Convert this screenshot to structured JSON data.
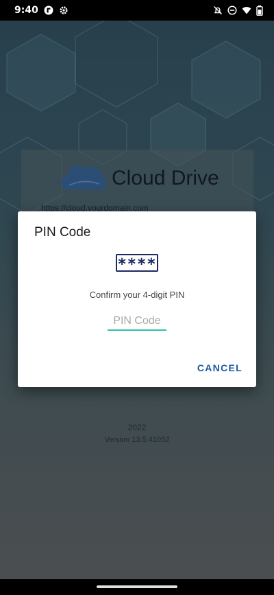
{
  "status_bar": {
    "time": "9:40",
    "icons": [
      "app-logo-icon",
      "settings-gear-icon",
      "notifications-off-icon",
      "do-not-disturb-icon",
      "wifi-icon",
      "battery-icon"
    ]
  },
  "background": {
    "brand_name": "Cloud Drive",
    "server_url": "https://cloud.yourdomain.com",
    "footer_year": "2022",
    "footer_version": "Version 13.5.41052"
  },
  "dialog": {
    "title": "PIN Code",
    "pin_icon_text": "****",
    "message": "Confirm your 4-digit PIN",
    "pin_input_value": "",
    "pin_input_placeholder": "PIN Code",
    "cancel_label": "CANCEL"
  },
  "colors": {
    "accent_underline": "#2bc3ad",
    "cancel_text": "#1a59a0",
    "pin_icon": "#1c2a63",
    "brand_cloud": "#2a4e75"
  }
}
